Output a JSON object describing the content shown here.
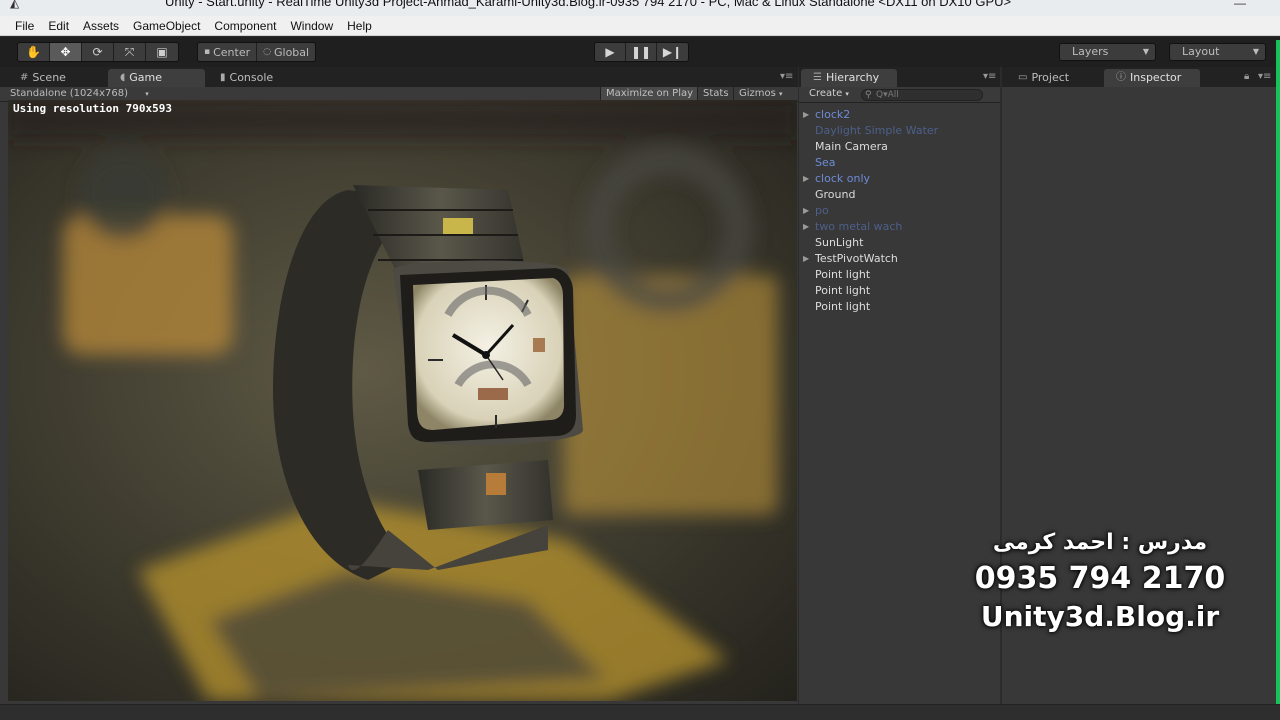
{
  "window": {
    "title": "Unity - Start.unity - RealTime Unity3d Project-Ahmad_Karami-Unity3d.Blog.ir-0935 794 2170 - PC, Mac & Linux Standalone <DX11 on DX10 GPU>",
    "app_icon": "unity-logo-icon",
    "minimize_glyph": "—"
  },
  "menu": {
    "items": [
      "File",
      "Edit",
      "Assets",
      "GameObject",
      "Component",
      "Window",
      "Help"
    ]
  },
  "toolbar": {
    "tools": [
      "hand-icon",
      "move-icon",
      "rotate-icon",
      "scale-icon",
      "rect-icon"
    ],
    "active_tool": "move-icon",
    "pivot_label": "Center",
    "space_label": "Global",
    "layers_label": "Layers",
    "layout_label": "Layout"
  },
  "game_panel": {
    "tabs": [
      "Scene",
      "Game",
      "Console"
    ],
    "active_tab": "Game",
    "resolution_select": "Standalone (1024x768)",
    "maximize_on_play": "Maximize on Play",
    "stats": "Stats",
    "gizmos": "Gizmos",
    "using_resolution": "Using resolution 790x593"
  },
  "hierarchy": {
    "tab_label": "Hierarchy",
    "create_label": "Create",
    "search_placeholder": "Q▾All",
    "items": [
      {
        "label": "clock2",
        "style": "prefab",
        "foldout": true
      },
      {
        "label": "Daylight Simple Water",
        "style": "disabled",
        "foldout": false
      },
      {
        "label": "Main Camera",
        "style": "normal",
        "foldout": false
      },
      {
        "label": "Sea",
        "style": "prefab",
        "foldout": false
      },
      {
        "label": "clock only",
        "style": "prefab",
        "foldout": true
      },
      {
        "label": "Ground",
        "style": "normal",
        "foldout": false
      },
      {
        "label": "po",
        "style": "disabled",
        "foldout": true
      },
      {
        "label": "two metal wach",
        "style": "disabled",
        "foldout": true
      },
      {
        "label": "SunLight",
        "style": "normal",
        "foldout": false
      },
      {
        "label": "TestPivotWatch",
        "style": "normal",
        "foldout": true
      },
      {
        "label": "Point light",
        "style": "normal",
        "foldout": false
      },
      {
        "label": "Point light",
        "style": "normal",
        "foldout": false
      },
      {
        "label": "Point light",
        "style": "normal",
        "foldout": false
      }
    ]
  },
  "inspector": {
    "project_tab": "Project",
    "inspector_tab": "Inspector"
  },
  "overlay": {
    "line1": "مدرس : احمد کرمی",
    "line2": "0935 794 2170",
    "line3": "Unity3d.Blog.ir"
  },
  "colors": {
    "prefab_text": "#6e8bd6",
    "disabled_prefab_text": "#4d5f8a",
    "accent_green": "#18c25a"
  }
}
